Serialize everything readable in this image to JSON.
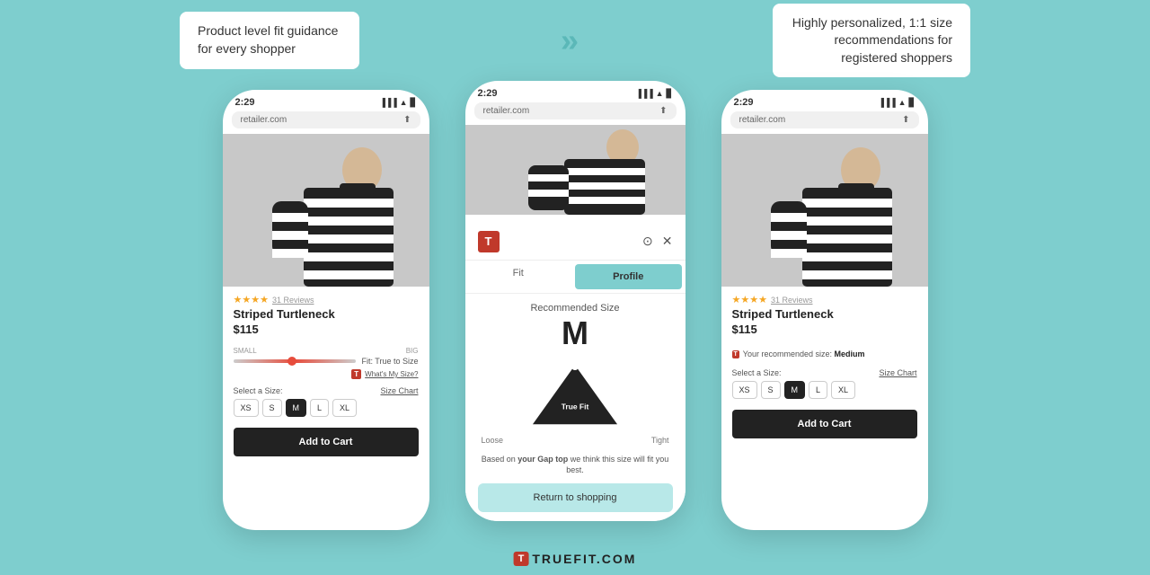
{
  "topSection": {
    "leftText": "Product level fit guidance for every shopper",
    "rightText": "Highly personalized, 1:1 size recommendations for registered shoppers",
    "chevron": "»"
  },
  "phones": {
    "left": {
      "time": "2:29",
      "url": "retailer.com",
      "stars": "★★★★",
      "reviews": "31 Reviews",
      "productName": "Striped Turtleneck",
      "price": "$115",
      "fitLabel": "Fit: True to Size",
      "fitSmall": "SMALL",
      "fitBig": "BIG",
      "whatsMySize": "What's My Size?",
      "selectSize": "Select a Size:",
      "sizeChart": "Size Chart",
      "sizes": [
        "XS",
        "S",
        "M",
        "L",
        "XL"
      ],
      "selectedSize": "M",
      "addToCart": "Add to Cart"
    },
    "middle": {
      "time": "2:29",
      "url": "retailer.com",
      "tabFit": "Fit",
      "tabProfile": "Profile",
      "recommendedSizeLabel": "Recommended Size",
      "recommendedSizeLetter": "M",
      "trueFitLabel": "True Fit",
      "looseLabel": "Loose",
      "tightLabel": "Tight",
      "basedOnText1": "Based on ",
      "basedOnBold": "your Gap top",
      "basedOnText2": " we think this size will fit you best.",
      "returnBtn": "Return to shopping"
    },
    "right": {
      "time": "2:29",
      "url": "retailer.com",
      "stars": "★★★★",
      "reviews": "31 Reviews",
      "productName": "Striped Turtleneck",
      "price": "$115",
      "recommendedText": "Your recommended size:",
      "recommendedSize": "Medium",
      "selectSize": "Select a Size:",
      "sizeChart": "Size Chart",
      "sizes": [
        "XS",
        "S",
        "M",
        "L",
        "XL"
      ],
      "selectedSize": "M",
      "addToCart": "Add to Cart"
    }
  },
  "bottomLogo": {
    "t": "T",
    "text": "TRUEFIT.COM"
  }
}
